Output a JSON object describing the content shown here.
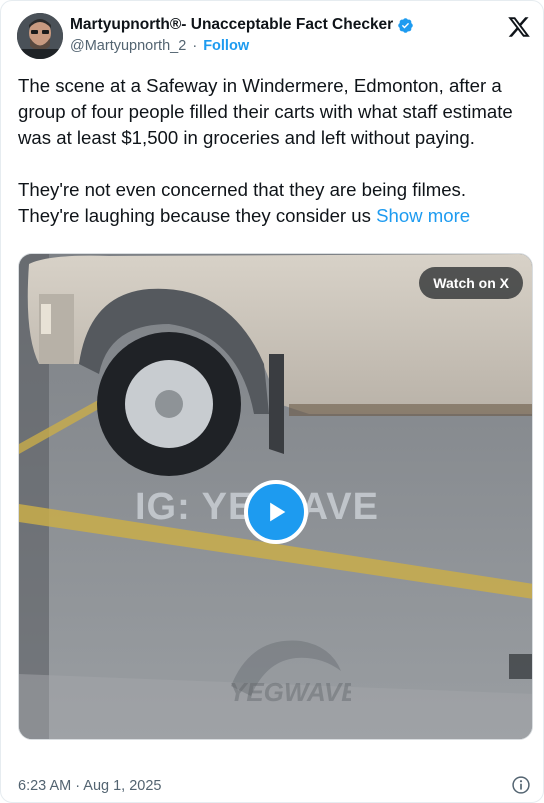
{
  "author": {
    "display_name": "Martyupnorth®- Unacceptable Fact Checker",
    "handle": "@Martyupnorth_2",
    "separator": "·",
    "follow_label": "Follow"
  },
  "tweet": {
    "paragraph_1": "The scene at a Safeway in Windermere, Edmonton, after a group of four people filled their carts with what staff estimate was at least $1,500 in groceries and left without paying.",
    "paragraph_2": "They're not even concerned that they are being filmes. They're laughing because they consider us ",
    "show_more": "Show more"
  },
  "media": {
    "watch_label": "Watch on X",
    "watermark_text": "IG: YE  WAVE",
    "logo_watermark_text": "YEGWAVE"
  },
  "footer": {
    "timestamp": "6:23 AM · Aug 1, 2025"
  },
  "colors": {
    "accent": "#1d9bf0",
    "text": "#0f1419",
    "secondary": "#536471"
  },
  "icons": [
    "verified-badge-icon",
    "x-logo-icon",
    "play-icon",
    "info-icon"
  ]
}
